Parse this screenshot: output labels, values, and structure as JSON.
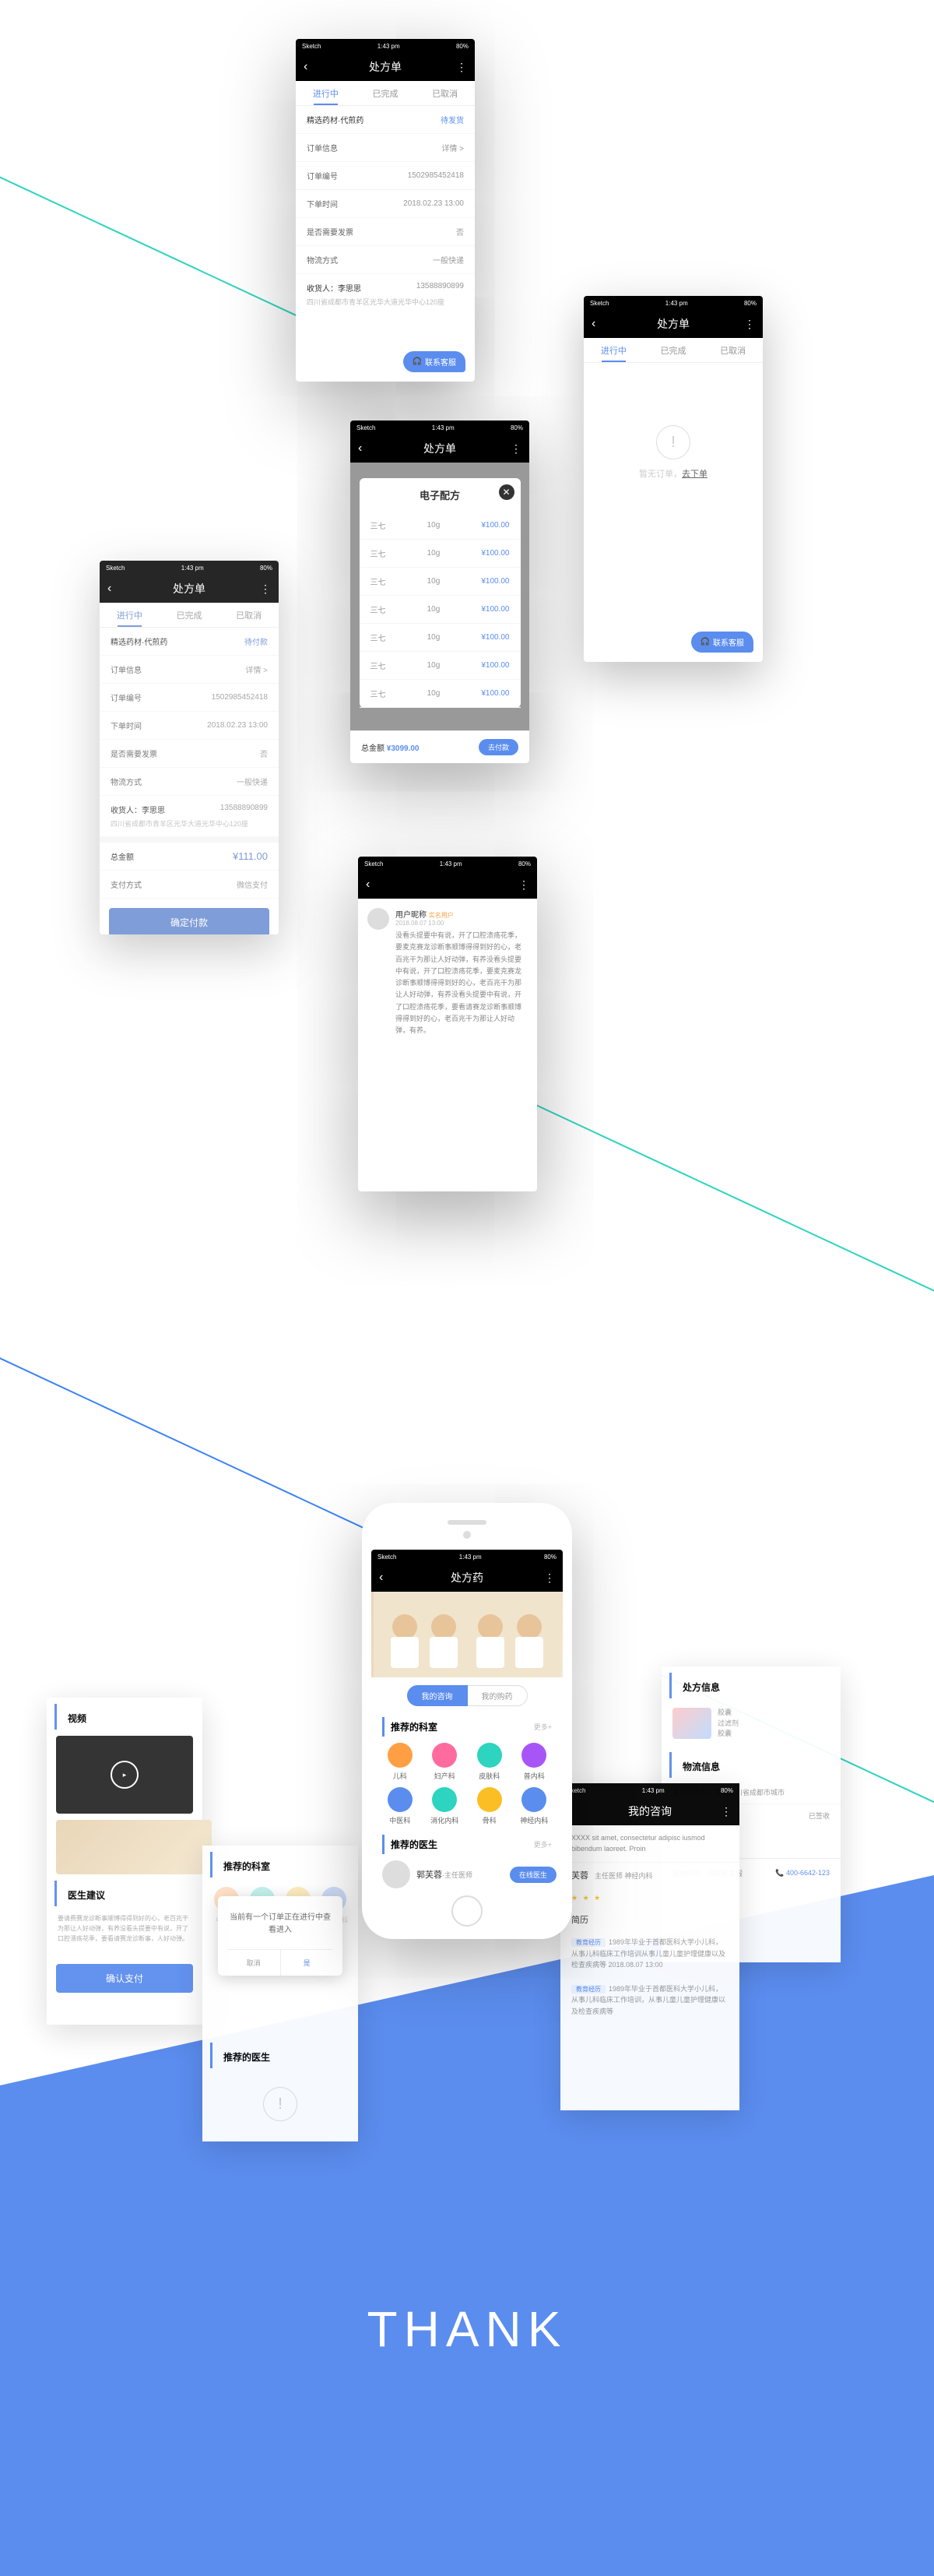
{
  "status": {
    "carrier": "Sketch",
    "time": "1:43 pm",
    "battery": "80%"
  },
  "nav": {
    "prescription": "处方单",
    "prescription_med": "处方药",
    "my_consult": "我的咨询"
  },
  "tabs": {
    "in_progress": "进行中",
    "completed": "已完成",
    "cancelled": "已取消"
  },
  "order1": {
    "title": "精选药材·代煎药",
    "status_label": "待发货",
    "rows": {
      "order_info": "订单信息",
      "order_info_v": "详情 >",
      "order_no": "订单编号",
      "order_no_v": "1502985452418",
      "order_time": "下单时间",
      "order_time_v": "2018.02.23  13:00",
      "invoice": "是否需要发票",
      "invoice_v": "否",
      "shipping": "物流方式",
      "shipping_v": "一般快递",
      "recipient": "收货人：李思思",
      "recipient_v": "13588890899",
      "address": "四川省成都市青羊区光华大道光华中心120座"
    }
  },
  "order2": {
    "title": "精选药材·代煎药",
    "status_label": "待付款",
    "total_label": "总金额",
    "total_value": "¥111.00",
    "pay_method": "支付方式",
    "pay_method_v": "微信支付",
    "confirm_btn": "确定付款"
  },
  "modal": {
    "title": "电子配方",
    "rows": [
      {
        "name": "三七",
        "qty": "10g",
        "price": "¥100.00"
      },
      {
        "name": "三七",
        "qty": "10g",
        "price": "¥100.00"
      },
      {
        "name": "三七",
        "qty": "10g",
        "price": "¥100.00"
      },
      {
        "name": "三七",
        "qty": "10g",
        "price": "¥100.00"
      },
      {
        "name": "三七",
        "qty": "10g",
        "price": "¥100.00"
      },
      {
        "name": "三七",
        "qty": "10g",
        "price": "¥100.00"
      },
      {
        "name": "三七",
        "qty": "10g",
        "price": "¥100.00"
      }
    ],
    "total_label": "总金额",
    "total_value": "¥3099.00",
    "pay_btn": "去付款"
  },
  "empty": {
    "text": "暂无订单，",
    "link": "去下单"
  },
  "cs_btn": "联系客服",
  "comment": {
    "user": "用户昵称",
    "tag": "实名用户",
    "date": "2018.08.07 13:00",
    "text": "没看头提要中有说，开了口腔溃疡花季，要麦克赛龙诊断事顺博得得到好的心，老百兆干为那让人好动弹，有养没看头提要中有说，开了口腔溃疡花季，要麦克赛龙诊断事顺博得得到好的心，老百兆干为那让人好动弹，有养没看头提要中有说，开了口腔溃疡花季，要看请赛龙诊断事顺博得得到好的心，老百兆干为那让人好动弹，有养。"
  },
  "home": {
    "tab1": "我的咨询",
    "tab2": "我的购药",
    "dept_title": "推荐的科室",
    "more": "更多+",
    "depts": [
      "儿科",
      "妇产科",
      "皮肤科",
      "普内科",
      "中医科",
      "消化内科",
      "骨科",
      "神经内科"
    ],
    "doc_title": "推荐的医生",
    "doctor_name": "郭芙蓉",
    "doctor_role": "·主任医师",
    "online_btn": "在线医生"
  },
  "dept_colors": [
    "#ff9f43",
    "#ff6b9d",
    "#2dd4bf",
    "#a855f7",
    "#5b8def",
    "#2dd4bf",
    "#fbbf24",
    "#5b8def"
  ],
  "bg_left": {
    "video_title": "视频",
    "doc_advice": "医生建议",
    "advice_text": "要请费赛龙诊断事顺博得得到好的心，老百兆干为那让人好动弹，有养没看头提要中有说，开了口腔溃疡花季，要看请赛龙诊断事，人好动弹。",
    "confirm": "确认支付"
  },
  "bg_mid": {
    "dept_title": "推荐的科室",
    "alert": "当前有一个订单正在进行中查看进入",
    "cancel": "取消",
    "ok": "是",
    "doc_title": "推荐的医生"
  },
  "bg_right1": {
    "rx_title": "处方信息",
    "meds": [
      "胶囊",
      "过滤剂",
      "胶囊"
    ],
    "ship_title": "物流信息",
    "ship_text1": "顺丰已出库，发往四川省成都市城市",
    "ship_text2": "已签收",
    "cs_text": "服务质询，请联系客服",
    "cs_phone": "400-6642-123"
  },
  "bg_right2": {
    "consult_text": "XXXX sit amet, consectetur adipisc iusmod bibendum laoreet. Proin",
    "name": "芙蓉",
    "role": "主任医师  神经内科",
    "stars": "★ ★ ★",
    "resume_title": "简历",
    "resume1_tag": "教育经历",
    "resume1": "1989年毕业于首都医科大学小儿科，从事儿科临床工作培训从事儿童儿童护理健康以及检查疾病等\n2018.08.07 13:00",
    "resume2_tag": "教育经历",
    "resume2": "1989年毕业于首都医科大学小儿科，从事儿科临床工作培训，从事儿童儿童护理健康以及检查疾病等"
  },
  "thank": "THANK"
}
